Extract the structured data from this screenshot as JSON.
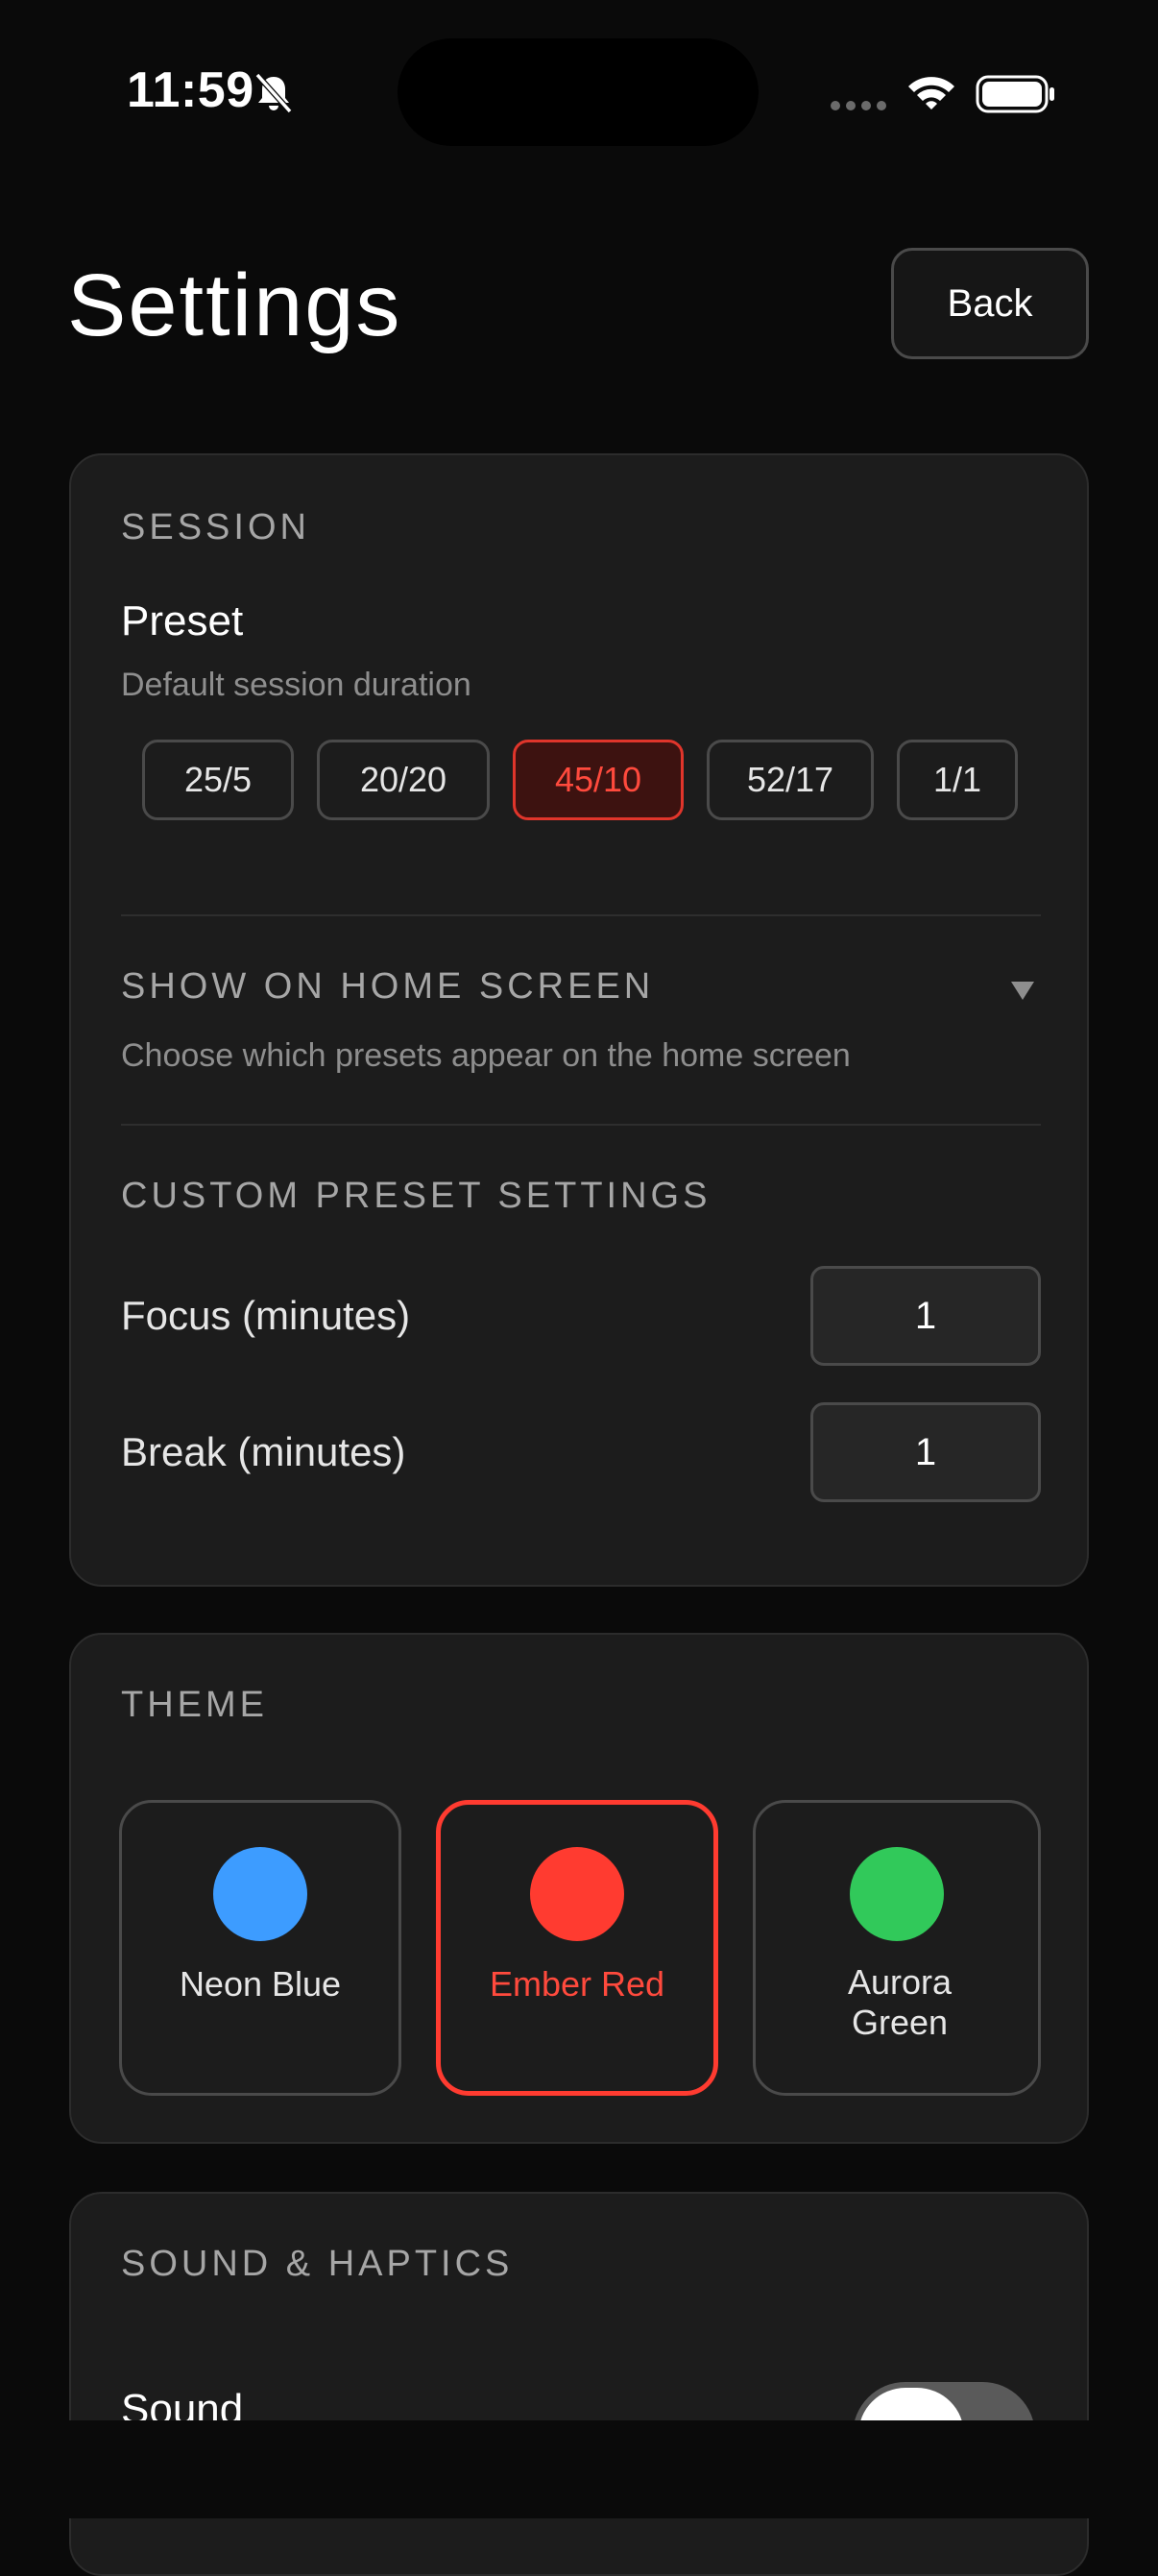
{
  "status_bar": {
    "time": "11:59",
    "icons": [
      "bell-slash-icon",
      "signal-dots-icon",
      "wifi-icon",
      "battery-icon"
    ]
  },
  "header": {
    "title": "Settings",
    "back_label": "Back"
  },
  "session": {
    "section_label": "SESSION",
    "preset_title": "Preset",
    "preset_subtitle": "Default session duration",
    "presets": [
      {
        "label": "25/5",
        "selected": false
      },
      {
        "label": "20/20",
        "selected": false
      },
      {
        "label": "45/10",
        "selected": true
      },
      {
        "label": "52/17",
        "selected": false
      },
      {
        "label": "1/1",
        "selected": false
      }
    ],
    "home_screen_label": "SHOW ON HOME SCREEN",
    "home_screen_subtitle": "Choose which presets appear on the home screen",
    "custom_label": "CUSTOM PRESET SETTINGS",
    "focus_label": "Focus (minutes)",
    "focus_value": "1",
    "break_label": "Break (minutes)",
    "break_value": "1"
  },
  "theme": {
    "section_label": "THEME",
    "options": [
      {
        "name": "Neon Blue",
        "color": "#3d9cff",
        "selected": false
      },
      {
        "name": "Ember Red",
        "color": "#ff3b30",
        "selected": true
      },
      {
        "name": "Aurora Green",
        "color": "#31c95a",
        "selected": false
      }
    ],
    "accent_color": "#ff3b30"
  },
  "sound_haptics": {
    "section_label": "SOUND & HAPTICS",
    "sound_label": "Sound"
  }
}
